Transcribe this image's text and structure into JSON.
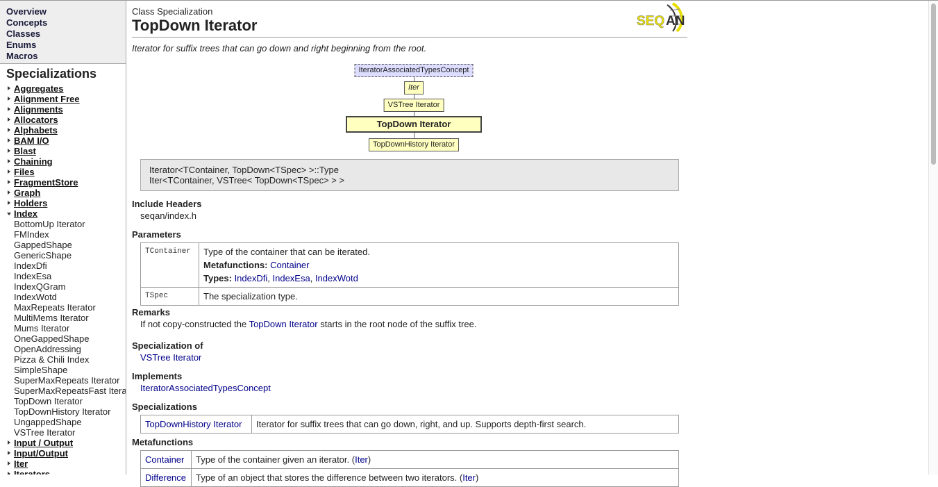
{
  "sidebar": {
    "nav": [
      "Overview",
      "Concepts",
      "Classes",
      "Enums",
      "Macros"
    ],
    "section_title": "Specializations",
    "groups_before": [
      "Aggregates",
      "Alignment Free",
      "Alignments",
      "Allocators",
      "Alphabets",
      "BAM I/O",
      "Blast",
      "Chaining",
      "Files",
      "FragmentStore",
      "Graph",
      "Holders"
    ],
    "open_group": "Index",
    "open_items": [
      "BottomUp Iterator",
      "FMIndex",
      "GappedShape",
      "GenericShape",
      "IndexDfi",
      "IndexEsa",
      "IndexQGram",
      "IndexWotd",
      "MaxRepeats Iterator",
      "MultiMems Iterator",
      "Mums Iterator",
      "OneGappedShape",
      "OpenAddressing",
      "Pizza & Chili Index",
      "SimpleShape",
      "SuperMaxRepeats Iterator",
      "SuperMaxRepeatsFast Iterator",
      "TopDown Iterator",
      "TopDownHistory Iterator",
      "UngappedShape",
      "VSTree Iterator"
    ],
    "groups_after": [
      "Input / Output",
      "Input/Output",
      "Iter",
      "Iterators"
    ]
  },
  "header": {
    "kind": "Class Specialization",
    "title": "TopDown Iterator",
    "logo": "SEQAN",
    "description": "Iterator for suffix trees that can go down and right beginning from the root."
  },
  "diagram": {
    "concept": "IteratorAssociatedTypesConcept",
    "n1": "Iter",
    "n2": "VSTree Iterator",
    "current": "TopDown Iterator",
    "child": "TopDownHistory Iterator"
  },
  "signature": [
    "Iterator<TContainer, TopDown<TSpec> >::Type",
    "Iter<TContainer, VSTree< TopDown<TSpec> > >"
  ],
  "include": {
    "heading": "Include Headers",
    "value": "seqan/index.h"
  },
  "params": {
    "heading": "Parameters",
    "p1": {
      "name": "TContainer",
      "desc": "Type of the container that can be iterated.",
      "mf_label": "Metafunctions:",
      "mf": "Container",
      "types_label": "Types:",
      "types": [
        "IndexDfi",
        "IndexEsa",
        "IndexWotd"
      ]
    },
    "p2": {
      "name": "TSpec",
      "desc": "The specialization type."
    }
  },
  "remarks": {
    "heading": "Remarks",
    "pre": "If not copy-constructed the ",
    "link": "TopDown Iterator",
    "post": " starts in the root node of the suffix tree."
  },
  "spec_of": {
    "heading": "Specialization of",
    "link": "VSTree Iterator"
  },
  "implements": {
    "heading": "Implements",
    "link": "IteratorAssociatedTypesConcept"
  },
  "specializations": {
    "heading": "Specializations",
    "name": "TopDownHistory Iterator",
    "desc": "Iterator for suffix trees that can go down, right, and up. Supports depth-first search."
  },
  "metafunctions": {
    "heading": "Metafunctions",
    "rows": [
      {
        "name": "Container",
        "desc": "Type of the container given an iterator. (",
        "link": "Iter",
        "end": ")"
      },
      {
        "name": "Difference",
        "desc": "Type of an object that stores the difference between two iterators. (",
        "link": "Iter",
        "end": ")"
      }
    ]
  }
}
